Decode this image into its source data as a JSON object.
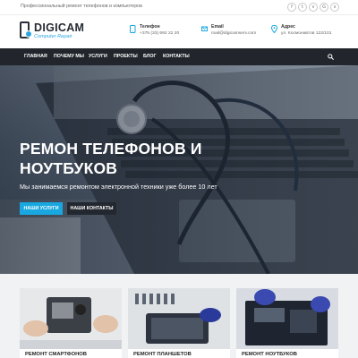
{
  "topbar": {
    "tagline": "Профессиональный ремонт телефонов и компьютеров",
    "socials": [
      {
        "icon": "facebook-icon",
        "glyph": "f"
      },
      {
        "icon": "twitter-icon",
        "glyph": "t"
      },
      {
        "icon": "vk-icon",
        "glyph": "v"
      },
      {
        "icon": "google-plus-icon",
        "glyph": "G"
      },
      {
        "icon": "skype-icon",
        "glyph": "s"
      }
    ]
  },
  "header": {
    "brand": "DIGICAM",
    "brand_sub": "Computer Repair",
    "phone": {
      "label": "Телефон",
      "value": "+375 (33) 692 22 20"
    },
    "email": {
      "label": "Email",
      "value": "mail@digicamserv.com"
    },
    "address": {
      "label": "Адрес",
      "value": "ул. Космонавтов 122/101"
    }
  },
  "nav": {
    "items": [
      "ГЛАВНАЯ",
      "ПОЧЕМУ МЫ",
      "УСЛУГИ",
      "ПРОЕКТЫ",
      "БЛОГ",
      "КОНТАКТЫ"
    ]
  },
  "hero": {
    "title": "РЕМОН ТЕЛЕФОНОВ И НОУТБУКОВ",
    "description": "Мы занимаемся ремонтом электронной техники уже более 10 лет",
    "primary_button": "НАШИ УСЛУГИ",
    "secondary_button": "НАШИ КОНТАКТЫ"
  },
  "services": [
    {
      "title": "РЕМОНТ СМАРТФОНОВ"
    },
    {
      "title": "РЕМОНТ ПЛАНШЕТОВ"
    },
    {
      "title": "РЕМОНТ НОУТБУКОВ"
    }
  ],
  "colors": {
    "accent": "#19a7e0",
    "nav_bg": "#22262c",
    "dark_button": "#232830"
  }
}
